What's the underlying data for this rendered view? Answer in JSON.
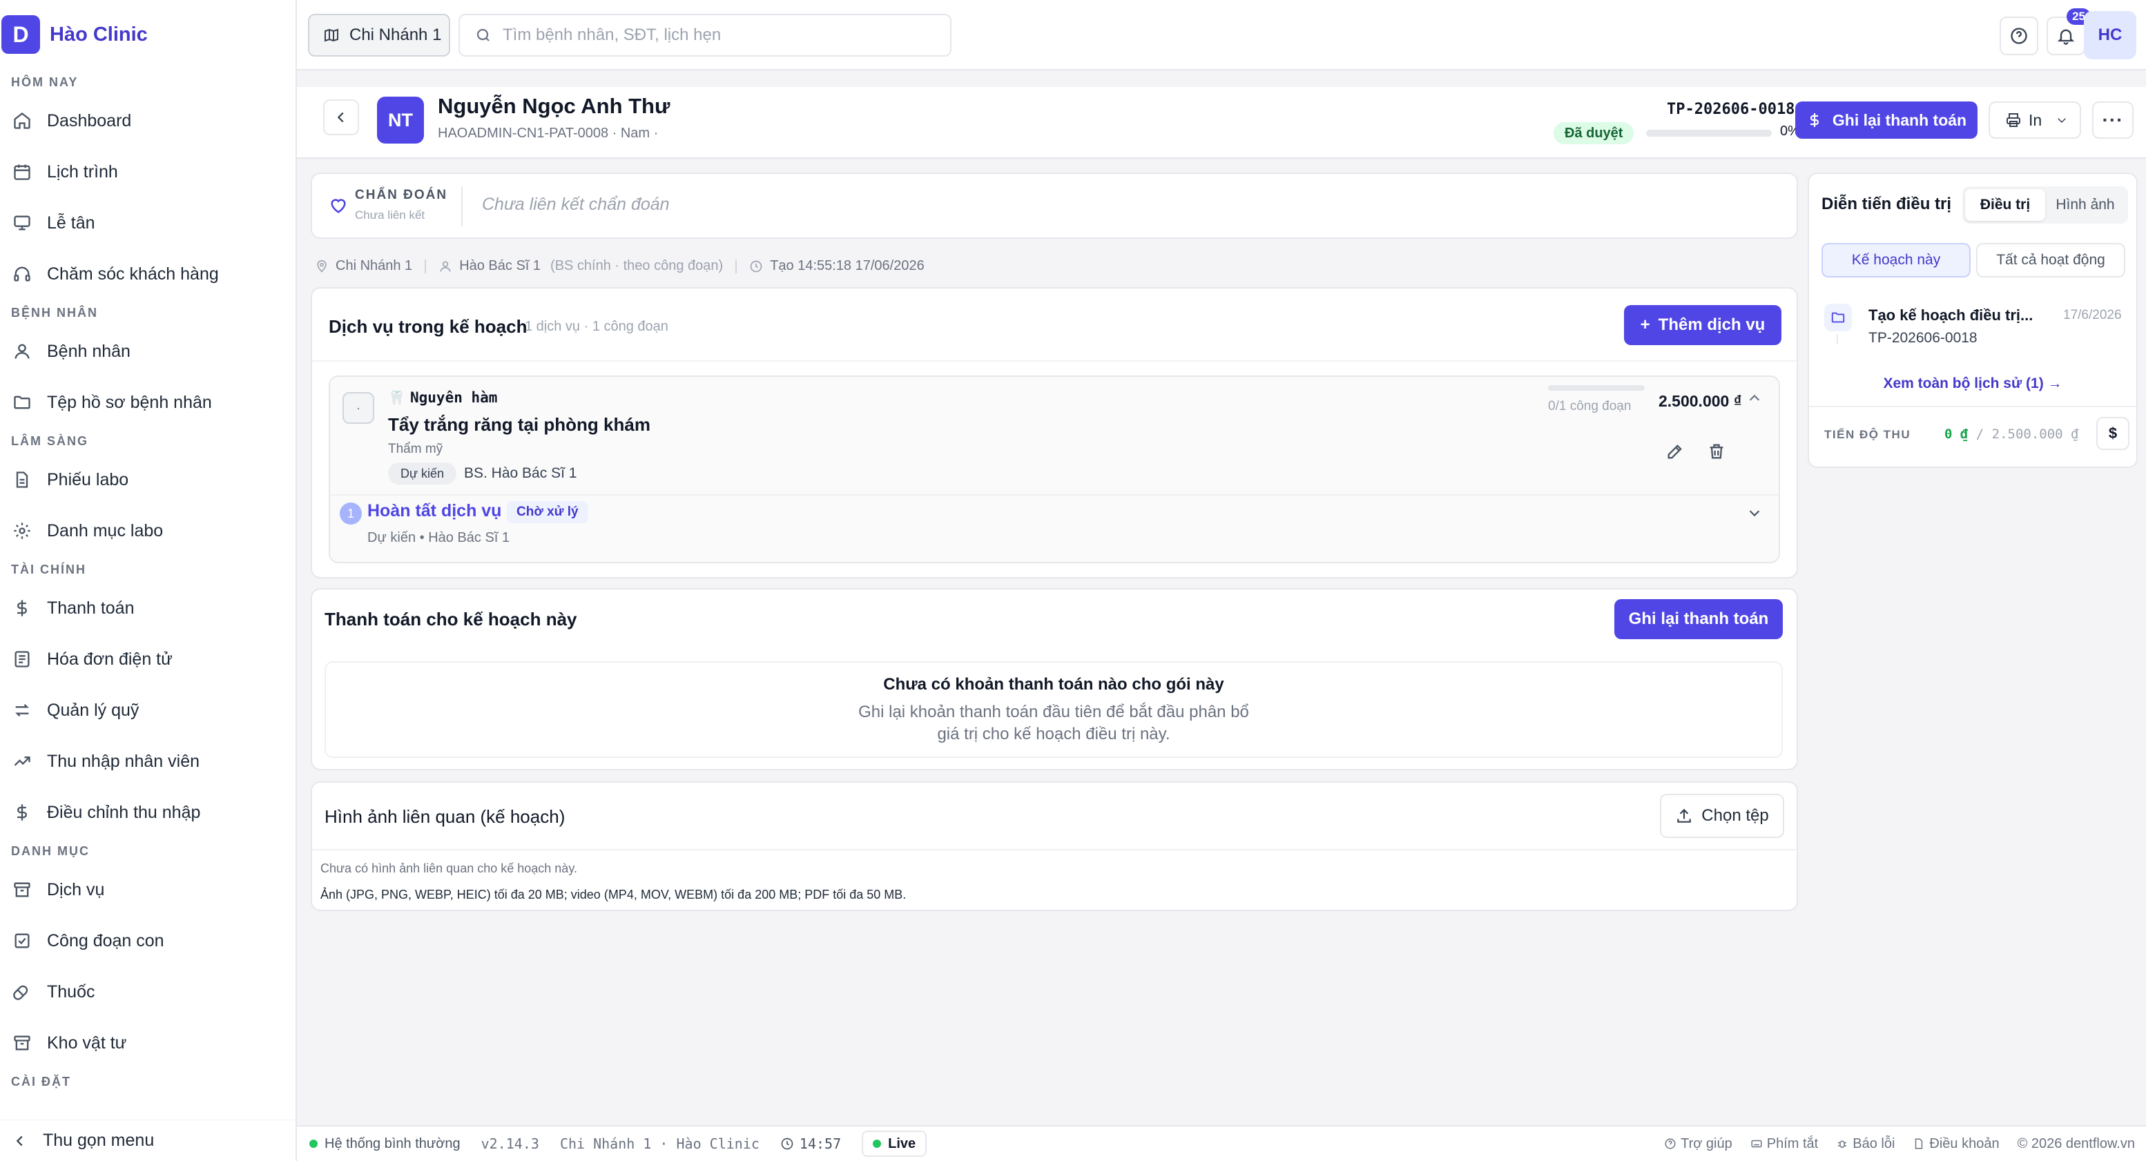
{
  "brand": {
    "logo_letter": "D",
    "name": "Hào Clinic"
  },
  "sidebar": {
    "sections": [
      {
        "title": "Hôm nay",
        "items": [
          {
            "label": "Dashboard",
            "icon": "home-icon"
          },
          {
            "label": "Lịch trình",
            "icon": "calendar-icon"
          },
          {
            "label": "Lễ tân",
            "icon": "monitor-icon"
          },
          {
            "label": "Chăm sóc khách hàng",
            "icon": "headphones-icon"
          }
        ]
      },
      {
        "title": "Bệnh nhân",
        "items": [
          {
            "label": "Bệnh nhân",
            "icon": "user-icon"
          },
          {
            "label": "Tệp hồ sơ bệnh nhân",
            "icon": "folder-icon"
          }
        ]
      },
      {
        "title": "Lâm sàng",
        "items": [
          {
            "label": "Phiếu labo",
            "icon": "file-icon"
          },
          {
            "label": "Danh mục labo",
            "icon": "gear-icon"
          }
        ]
      },
      {
        "title": "Tài chính",
        "items": [
          {
            "label": "Thanh toán",
            "icon": "dollar-icon"
          },
          {
            "label": "Hóa đơn điện tử",
            "icon": "receipt-icon"
          },
          {
            "label": "Quản lý quỹ",
            "icon": "swap-icon"
          },
          {
            "label": "Thu nhập nhân viên",
            "icon": "trend-icon"
          },
          {
            "label": "Điều chỉnh thu nhập",
            "icon": "dollar-icon"
          }
        ]
      },
      {
        "title": "Danh mục",
        "items": [
          {
            "label": "Dịch vụ",
            "icon": "archive-icon"
          },
          {
            "label": "Công đoạn con",
            "icon": "checkbox-icon"
          },
          {
            "label": "Thuốc",
            "icon": "pill-icon"
          },
          {
            "label": "Kho vật tư",
            "icon": "archive-icon"
          }
        ]
      },
      {
        "title": "Cài đặt",
        "items": []
      }
    ],
    "collapse_label": "Thu gọn menu"
  },
  "topbar": {
    "branch": "Chi Nhánh 1",
    "search_placeholder": "Tìm bệnh nhân, SĐT, lịch hẹn",
    "notifications_count": "25",
    "user_initials": "HC"
  },
  "patient": {
    "initials": "NT",
    "name": "Nguyễn Ngọc Anh Thư",
    "subtitle": "HAOADMIN-CN1-PAT-0008 · Nam ·",
    "plan_code": "TP-202606-0018",
    "status": "Đã duyệt",
    "progress": 0,
    "progress_label": "0%",
    "record_payment_label": "Ghi lại thanh toán",
    "print_label": "In"
  },
  "diagnosis": {
    "title": "Chẩn đoán",
    "subtitle": "Chưa liên kết",
    "empty": "Chưa liên kết chẩn đoán"
  },
  "meta": {
    "branch": "Chi Nhánh 1",
    "doctor": "Hào Bác Sĩ 1",
    "doctor_note": "(BS chính · theo công đoạn)",
    "created": "Tạo 14:55:18 17/06/2026"
  },
  "services": {
    "title": "Dịch vụ trong kế hoạch",
    "count": "1 dịch vụ · 1 công đoạn",
    "add_label": "Thêm dịch vụ",
    "item": {
      "bullet": "·",
      "tooth_icon": "🦷",
      "category": "Nguyên hàm",
      "name": "Tẩy trắng răng tại phòng khám",
      "group": "Thẩm mỹ",
      "status": "Dự kiến",
      "doctor": "BS. Hào Bác Sĩ 1",
      "stage_count": "0/1 công đoạn",
      "price": "2.500.000 ₫",
      "step": {
        "number": "1",
        "title": "Hoàn tất dịch vụ",
        "badge": "Chờ xử lý",
        "subtitle": "Dự kiến • Hào Bác Sĩ 1"
      }
    }
  },
  "payments": {
    "title": "Thanh toán cho kế hoạch này",
    "button": "Ghi lại thanh toán",
    "empty_title": "Chưa có khoản thanh toán nào cho gói này",
    "empty_desc_1": "Ghi lại khoản thanh toán đầu tiên để bắt đầu phân bổ",
    "empty_desc_2": "giá trị cho kế hoạch điều trị này."
  },
  "images": {
    "title": "Hình ảnh liên quan (kế hoạch)",
    "button": "Chọn tệp",
    "empty": "Chưa có hình ảnh liên quan cho kế hoạch này.",
    "hint": "Ảnh (JPG, PNG, WEBP, HEIC) tối đa 20 MB; video (MP4, MOV, WEBM) tối đa 200 MB; PDF tối đa 50 MB."
  },
  "side_panel": {
    "title": "Diễn tiến điều trị",
    "tabs": [
      "Điều trị",
      "Hình ảnh"
    ],
    "filters": [
      "Kế hoạch này",
      "Tất cả hoạt động"
    ],
    "entry": {
      "title": "Tạo kế hoạch điều trị...",
      "date": "17/6/2026",
      "code": "TP-202606-0018"
    },
    "history_link": "Xem toàn bộ lịch sử (1)",
    "revenue_label": "Tiến độ thu",
    "revenue_paid": "0 ₫",
    "revenue_total": " / 2.500.000 ₫",
    "revenue_btn": "$"
  },
  "statusbar": {
    "system": "Hệ thống bình thường",
    "version": "v2.14.3",
    "location": "Chi Nhánh 1 · Hào Clinic",
    "time": "14:57",
    "live": "Live",
    "links": [
      "Trợ giúp",
      "Phím tắt",
      "Báo lỗi",
      "Điều khoản"
    ],
    "copyright": "© 2026 dentflow.vn"
  }
}
